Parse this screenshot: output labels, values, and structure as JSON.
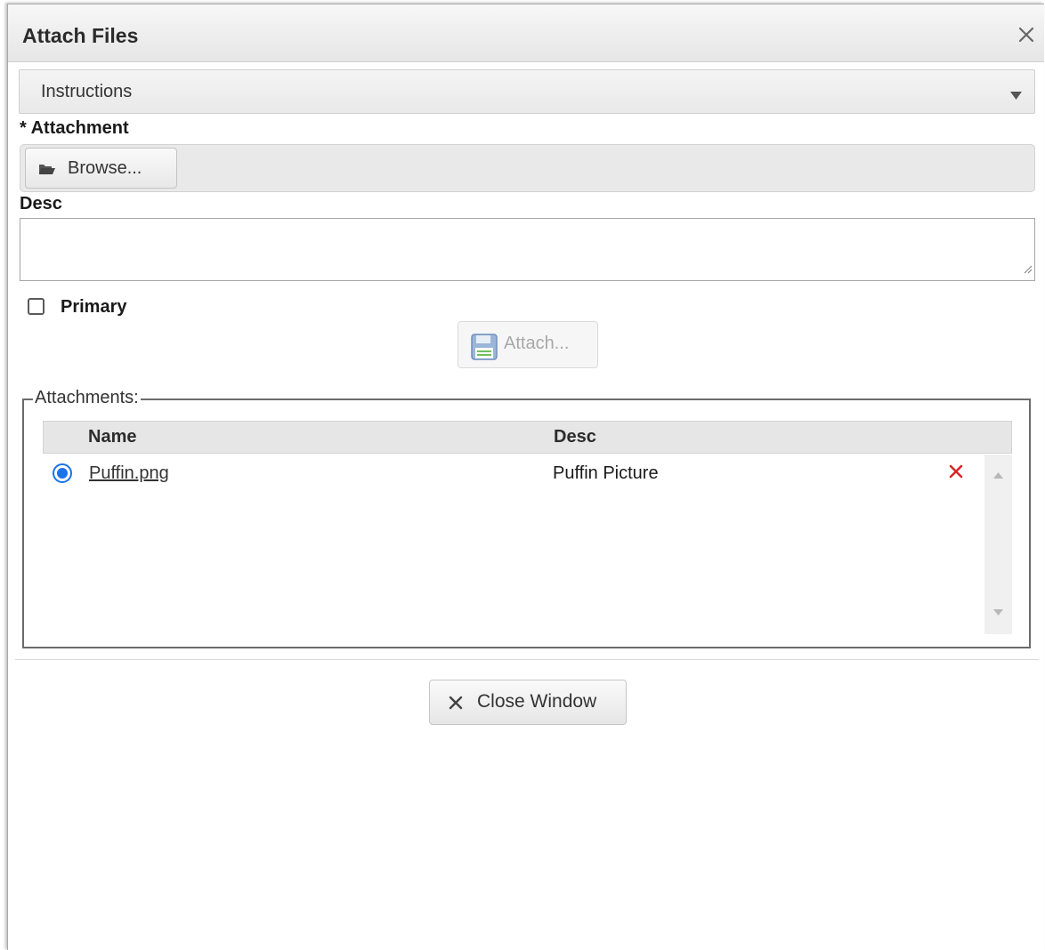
{
  "dialog": {
    "title": "Attach Files",
    "close_icon": "close-icon"
  },
  "instructions": {
    "label": "Instructions",
    "caret_icon": "caret-down-icon"
  },
  "form": {
    "attachment_label": "* Attachment",
    "browse_label": "Browse...",
    "browse_icon": "folder-open-icon",
    "desc_label": "Desc",
    "desc_value": "",
    "primary_label": "Primary",
    "primary_checked": false,
    "attach_label": "Attach...",
    "attach_icon": "floppy-disk-icon",
    "attach_enabled": false
  },
  "attachments": {
    "legend": "Attachments:",
    "columns": [
      "Name",
      "Desc"
    ],
    "rows": [
      {
        "name": "Puffin.png",
        "desc": "Puffin Picture",
        "selected": true
      }
    ]
  },
  "footer": {
    "close_window_label": "Close Window",
    "close_window_icon": "close-icon"
  },
  "colors": {
    "accent_blue": "#1a73e8",
    "delete_red": "#d9262b"
  }
}
